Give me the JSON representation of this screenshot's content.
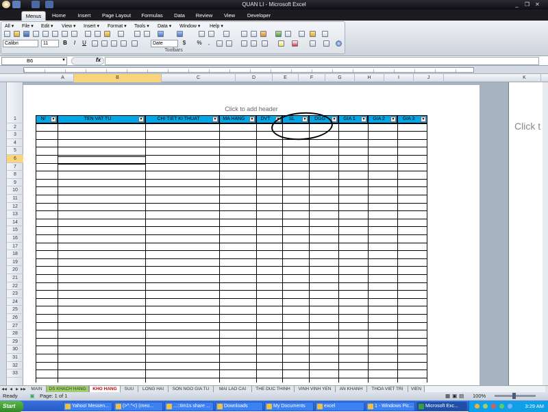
{
  "window": {
    "title": "QUAN LI - Microsoft Excel",
    "minimize": "_",
    "restore": "❐",
    "close": "✕"
  },
  "ribbon_tabs": [
    "Menus",
    "Home",
    "Insert",
    "Page Layout",
    "Formulas",
    "Data",
    "Review",
    "View",
    "Developer"
  ],
  "menus": [
    "All ▾",
    "File ▾",
    "Edit ▾",
    "View ▾",
    "Insert ▾",
    "Format ▾",
    "Tools ▾",
    "Data ▾",
    "Window ▾",
    "Help ▾"
  ],
  "toolbar": {
    "font": "Calibri",
    "size": "11",
    "number_format": "Date",
    "bold": "B",
    "italic": "I",
    "underline": "U",
    "currency": "$",
    "percent": "%",
    "comma": ",",
    "group_label": "Toolbars"
  },
  "formula_bar": {
    "name_box": "B6",
    "fx": "fx",
    "value": ""
  },
  "column_headers": [
    "A",
    "B",
    "C",
    "D",
    "E",
    "F",
    "G",
    "H",
    "I",
    "J",
    "K"
  ],
  "header_hint": "Click to add header",
  "page2_hint": "Click t",
  "table": {
    "headers": [
      "N/",
      "TEN VAT TU",
      "CHI TIET KI THUAT",
      "MA HANG",
      "DVT",
      "SL",
      "DGG",
      "GIA 1",
      "GIA 2",
      "GIA 3"
    ],
    "rows": 33,
    "selected_row": 6,
    "selected_cell": "B6",
    "annotation": "hand-drawn circle around SL header"
  },
  "row_numbers": [
    "1",
    "2",
    "3",
    "4",
    "5",
    "6",
    "7",
    "8",
    "9",
    "10",
    "11",
    "12",
    "13",
    "14",
    "15",
    "16",
    "17",
    "18",
    "19",
    "20",
    "21",
    "22",
    "23",
    "24",
    "25",
    "26",
    "27",
    "28",
    "29",
    "30",
    "31",
    "32",
    "33"
  ],
  "sheet_tabs": [
    "MAIN",
    "DS KHACH HANG",
    "KHO HANG",
    "SUU",
    "LONG HAI",
    "SON NGO GIA TU",
    "MAI LAO CAI",
    "THE DUC THINH",
    "VINH VINH YEN",
    "AN KHANH",
    "THOA VIET TRI",
    "VIEN"
  ],
  "active_sheet": "KHO HANG",
  "status": {
    "ready": "Ready",
    "page": "Page: 1 of 1",
    "zoom": "100%"
  },
  "taskbar": {
    "start": "Start",
    "items": [
      "Yahoo! Messen...",
      "(>^.^<) (meo...",
      "...::tim1s share ...",
      "Downloads",
      "My Documents",
      "excel",
      "1 - Windows Pic...",
      "Microsoft Exc..."
    ],
    "active_item": "Microsoft Exc...",
    "clock": "3:29 AM"
  },
  "colors": {
    "header_fill": "#00a6e6",
    "taskbar": "#245bc7",
    "selected_row": "#f9d67c"
  }
}
